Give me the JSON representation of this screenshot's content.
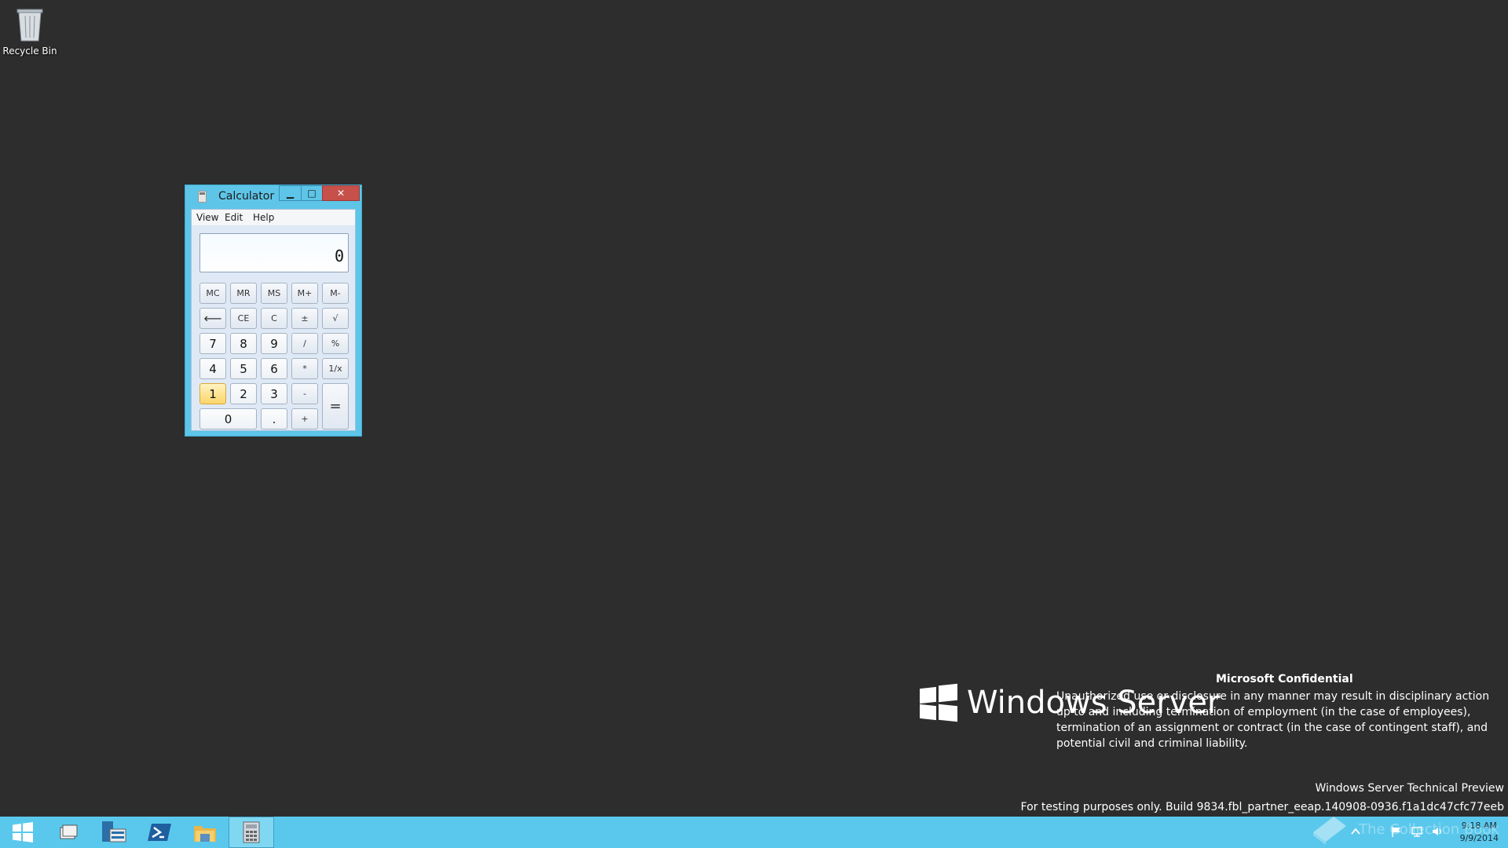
{
  "desktop": {
    "recycle_bin_label": "Recycle Bin"
  },
  "calculator": {
    "title": "Calculator",
    "menu": [
      "View",
      "Edit",
      "Help"
    ],
    "display": "0",
    "keys": {
      "mc": "MC",
      "mr": "MR",
      "ms": "MS",
      "mplus": "M+",
      "mminus": "M-",
      "back": "⟵",
      "ce": "CE",
      "c": "C",
      "plusminus": "±",
      "sqrt": "√",
      "k7": "7",
      "k8": "8",
      "k9": "9",
      "div": "/",
      "pct": "%",
      "k4": "4",
      "k5": "5",
      "k6": "6",
      "mul": "*",
      "recip": "1/x",
      "k1": "1",
      "k2": "2",
      "k3": "3",
      "sub": "-",
      "eq": "=",
      "k0": "0",
      "dot": ".",
      "add": "+"
    }
  },
  "branding": {
    "product": "Windows Server",
    "confidential_title": "Microsoft Confidential",
    "confidential_body": "Unauthorized use or disclosure in any manner may result in disciplinary action up to and including termination of employment (in the case of employees), termination of an assignment or contract (in the case of contingent staff), and potential civil and criminal liability.",
    "preview": "Windows Server Technical Preview",
    "build": "For testing purposes only. Build 9834.fbl_partner_eeap.140908-0936.f1a1dc47cfc77eeb"
  },
  "taskbar": {
    "clock_time": "9:18 AM",
    "clock_date": "9/9/2014",
    "watermark": "The Collection Book"
  },
  "colors": {
    "taskbar": "#5ac8ec",
    "desktop": "#2d2d2d",
    "window_frame": "#5ec5e8",
    "close_button": "#c7504a"
  }
}
